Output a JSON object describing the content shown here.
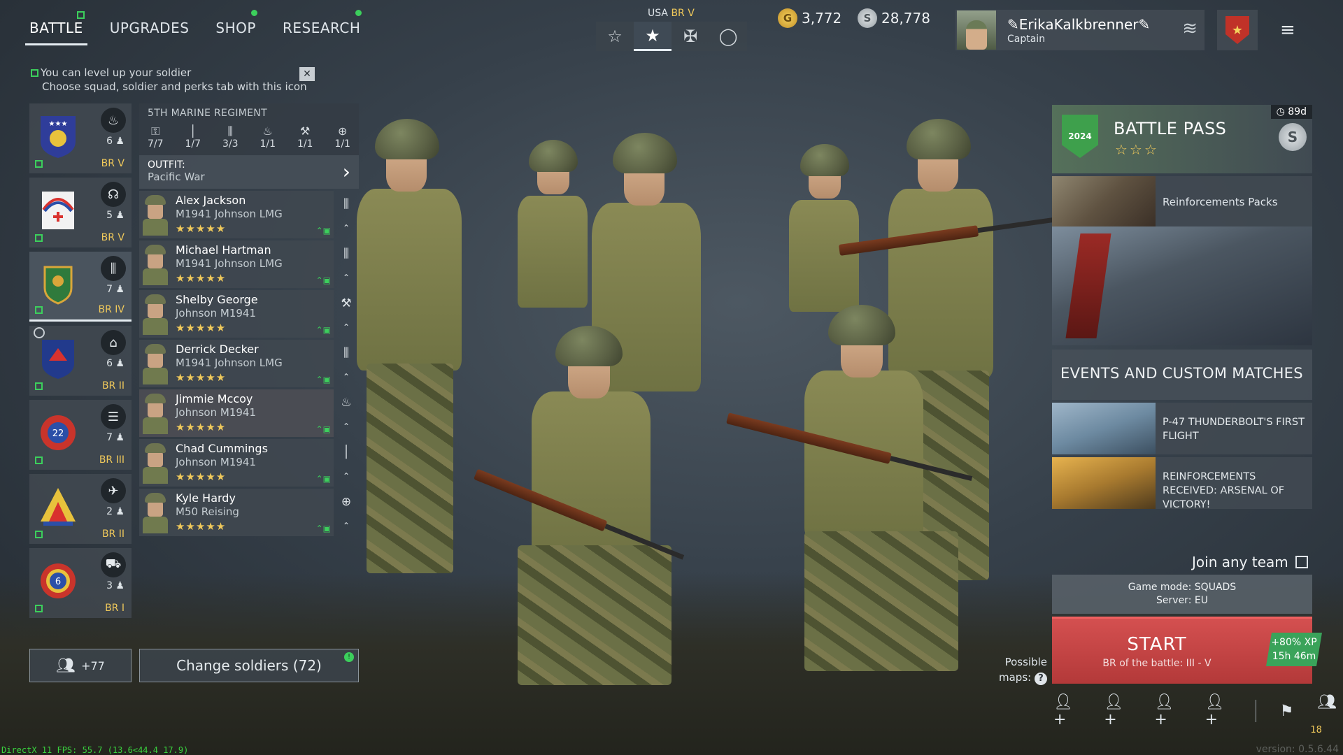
{
  "nav": {
    "tabs": [
      {
        "label": "BATTLE",
        "active": true
      },
      {
        "label": "UPGRADES"
      },
      {
        "label": "SHOP"
      },
      {
        "label": "RESEARCH"
      }
    ]
  },
  "hint": {
    "line1": "You can level up your soldier",
    "line2": "Choose squad, soldier and perks tab with this icon",
    "close": "✕"
  },
  "nation": {
    "country": "USA",
    "br": "BR V"
  },
  "modes": [
    {
      "icon": "star-outline-icon",
      "glyph": "☆"
    },
    {
      "icon": "usa-roundel-icon",
      "glyph": "★",
      "active": true
    },
    {
      "icon": "german-cross-icon",
      "glyph": "✠"
    },
    {
      "icon": "circle-icon",
      "glyph": "◯"
    }
  ],
  "currency": {
    "gold": "3,772",
    "silver": "28,778",
    "gold_symbol": "G",
    "silver_symbol": "S"
  },
  "profile": {
    "name": "ErikaKalkbrenner",
    "rank": "Captain"
  },
  "squads": [
    {
      "count": "6",
      "br": "BR V",
      "role_icon": "fire-icon",
      "role_glyph": "♨",
      "colors": [
        "#2f3d9a",
        "#e8c23c"
      ]
    },
    {
      "count": "5",
      "br": "BR V",
      "role_icon": "radio-icon",
      "role_glyph": "☊",
      "colors": [
        "#f2f2f2",
        "#d9322e"
      ]
    },
    {
      "count": "7",
      "br": "BR IV",
      "role_icon": "ammo-icon",
      "role_glyph": "⫼",
      "colors": [
        "#2f7a3c",
        "#d9a63a"
      ],
      "selected": true
    },
    {
      "count": "6",
      "br": "BR II",
      "role_icon": "paratrooper-icon",
      "role_glyph": "⌂",
      "colors": [
        "#223a8c",
        "#d9322e"
      ]
    },
    {
      "count": "7",
      "br": "BR III",
      "role_icon": "engineer-icon",
      "role_glyph": "☰",
      "colors": [
        "#c9342b",
        "#2b4fa8"
      ]
    },
    {
      "count": "2",
      "br": "BR II",
      "role_icon": "aircraft-icon",
      "role_glyph": "✈",
      "colors": [
        "#e8c23c",
        "#d9322e"
      ]
    },
    {
      "count": "3",
      "br": "BR I",
      "role_icon": "tank-icon",
      "role_glyph": "⛟",
      "colors": [
        "#c9342b",
        "#2b4fa8"
      ]
    }
  ],
  "squad_button": {
    "label": "+77"
  },
  "regiment": {
    "name": "5TH MARINE REGIMENT",
    "stats": [
      {
        "icon": "lock-icon",
        "glyph": "⚿",
        "value": "7/7"
      },
      {
        "icon": "rifle-icon",
        "glyph": "│",
        "value": "1/7"
      },
      {
        "icon": "ammo-icon",
        "glyph": "⫼",
        "value": "3/3"
      },
      {
        "icon": "fire-icon",
        "glyph": "♨",
        "value": "1/1"
      },
      {
        "icon": "wrench-icon",
        "glyph": "⚒",
        "value": "1/1"
      },
      {
        "icon": "medic-icon",
        "glyph": "⊕",
        "value": "1/1"
      }
    ]
  },
  "outfit": {
    "label": "OUTFIT:",
    "value": "Pacific War"
  },
  "soldiers": [
    {
      "name": "Alex Jackson",
      "weapon": "M1941 Johnson LMG",
      "stars": "★★★★★",
      "class_glyph": "⫼"
    },
    {
      "name": "Michael Hartman",
      "weapon": "M1941 Johnson LMG",
      "stars": "★★★★★",
      "class_glyph": "⫼"
    },
    {
      "name": "Shelby George",
      "weapon": "Johnson M1941",
      "stars": "★★★★★",
      "class_glyph": "⚒"
    },
    {
      "name": "Derrick Decker",
      "weapon": "M1941 Johnson LMG",
      "stars": "★★★★★",
      "class_glyph": "⫼"
    },
    {
      "name": "Jimmie Mccoy",
      "weapon": "Johnson M1941",
      "stars": "★★★★★",
      "class_glyph": "♨"
    },
    {
      "name": "Chad Cummings",
      "weapon": "Johnson M1941",
      "stars": "★★★★★",
      "class_glyph": "│"
    },
    {
      "name": "Kyle Hardy",
      "weapon": "M50 Reising",
      "stars": "★★★★★",
      "class_glyph": "⊕"
    }
  ],
  "change_soldiers": {
    "label": "Change soldiers (72)",
    "badge": "!"
  },
  "battle_pass": {
    "title": "BATTLE PASS",
    "stars": "☆☆☆",
    "time_left": "89d",
    "badge_year": "2024",
    "currency_symbol": "S"
  },
  "reinforcements": {
    "label": "Reinforcements Packs"
  },
  "events_header": "EVENTS AND CUSTOM MATCHES",
  "events": [
    {
      "label": "P-47 THUNDERBOLT'S FIRST FLIGHT"
    },
    {
      "label": "REINFORCEMENTS RECEIVED: ARSENAL OF VICTORY!"
    }
  ],
  "join_any_team": "Join any team",
  "game_mode": {
    "mode": "Game mode: SQUADS",
    "server": "Server: EU"
  },
  "start": {
    "label": "START",
    "br_range": "BR of the battle: III - V",
    "xp_bonus": "+80% XP",
    "xp_time": "15h 46m"
  },
  "possible_maps": {
    "line1": "Possible",
    "line2": "maps:",
    "q": "?"
  },
  "party": {
    "count": "18"
  },
  "debug": {
    "fps": "DirectX 11 FPS: 55.7 (13.6<44.4 17.9)",
    "version": "version: 0.5.6.44"
  },
  "colors": {
    "accent_green": "#3ccf5c",
    "gold": "#f0c95b",
    "start_red": "#c94444"
  }
}
